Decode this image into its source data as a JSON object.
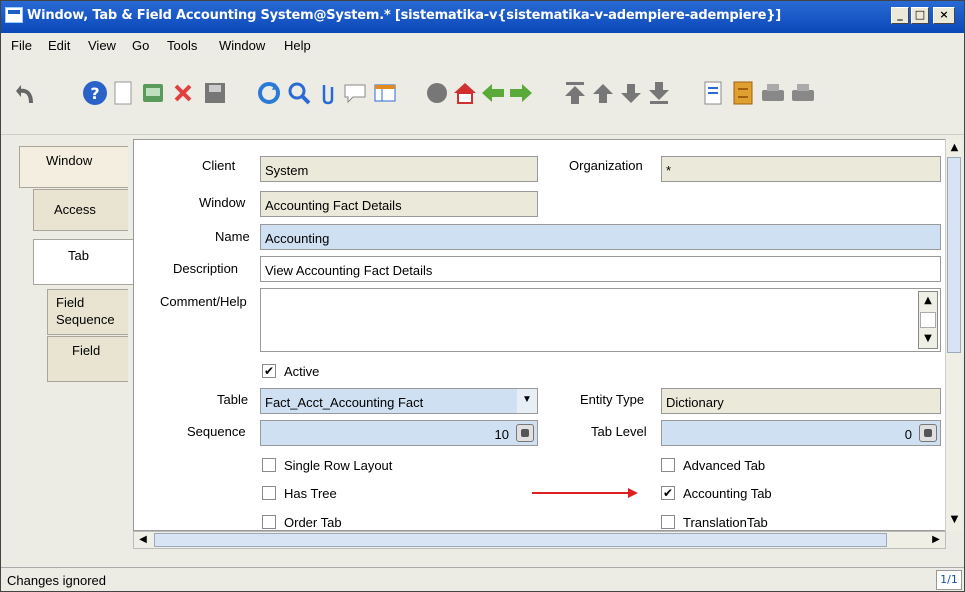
{
  "window": {
    "title": "Window, Tab & Field  Accounting  System@System.* [sistematika-v{sistematika-v-adempiere-adempiere}]",
    "min_label": "_",
    "max_label": "□",
    "close_label": "×"
  },
  "menu": [
    "File",
    "Edit",
    "View",
    "Go",
    "Tools",
    "Window",
    "Help"
  ],
  "toolbar": {
    "icons": [
      "undo-icon",
      "help-icon",
      "new-record-icon",
      "copy-record-icon",
      "delete-icon",
      "save-icon",
      "refresh-icon",
      "find-icon",
      "attachment-icon",
      "chat-icon",
      "grid-toggle-icon",
      "history-icon",
      "home-icon",
      "back-icon",
      "forward-icon",
      "first-record-icon",
      "previous-record-icon",
      "next-record-icon",
      "last-record-icon",
      "report-icon",
      "archive-icon",
      "print-preview-icon",
      "print-icon"
    ]
  },
  "tabs": [
    "Window",
    "Access",
    "Tab",
    "Field Sequence",
    "Field"
  ],
  "form": {
    "client_label": "Client",
    "client_value": "System",
    "org_label": "Organization",
    "org_value": "*",
    "window_label": "Window",
    "window_value": "Accounting Fact Details",
    "name_label": "Name",
    "name_value": "Accounting",
    "description_label": "Description",
    "description_value": "View Accounting Fact Details",
    "comment_label": "Comment/Help",
    "comment_value": "",
    "active_label": "Active",
    "active_checked": true,
    "table_label": "Table",
    "table_value": "Fact_Acct_Accounting Fact",
    "entity_label": "Entity Type",
    "entity_value": "Dictionary",
    "sequence_label": "Sequence",
    "sequence_value": "10",
    "tablevel_label": "Tab Level",
    "tablevel_value": "0",
    "single_row_label": "Single Row Layout",
    "single_row_checked": false,
    "advanced_label": "Advanced Tab",
    "advanced_checked": false,
    "has_tree_label": "Has Tree",
    "has_tree_checked": false,
    "accounting_tab_label": "Accounting Tab",
    "accounting_tab_checked": true,
    "order_tab_label": "Order Tab",
    "order_tab_checked": false,
    "translation_label": "TranslationTab",
    "translation_checked": false
  },
  "status": {
    "message": "Changes ignored",
    "record": "1/1"
  },
  "colors": {
    "titlebar": "#0a48b8",
    "mandatory_field": "#cfe0f2",
    "readonly_field": "#ebe9d9",
    "annotation_arrow": "#e02020"
  }
}
